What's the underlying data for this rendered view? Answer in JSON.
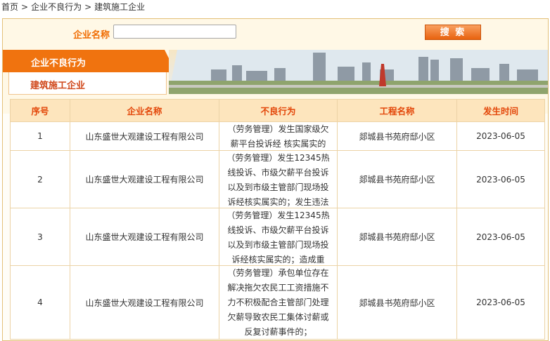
{
  "breadcrumb": [
    "首页",
    "企业不良行为",
    "建筑施工企业"
  ],
  "breadcrumb_sep": ">",
  "search": {
    "label": "企业名称",
    "value": "",
    "button": "搜  索"
  },
  "tabs": {
    "main": "企业不良行为",
    "sub": "建筑施工企业"
  },
  "table": {
    "headers": [
      "序号",
      "企业名称",
      "不良行为",
      "工程名称",
      "发生时间"
    ],
    "rows": [
      {
        "no": "1",
        "company": "山东盛世大观建设工程有限公司",
        "behavior": "（劳务管理）发生国家级欠薪平台投诉经 核实属实的",
        "project": "郯城县书苑府邸小区",
        "date": "2023-06-05"
      },
      {
        "no": "2",
        "company": "山东盛世大观建设工程有限公司",
        "behavior": "（劳务管理）发生12345热线投诉、市级欠薪平台投诉以及到市级主管部门现场投诉经核实属实的；发生违法违规行为的",
        "project": "郯城县书苑府邸小区",
        "date": "2023-06-05"
      },
      {
        "no": "3",
        "company": "山东盛世大观建设工程有限公司",
        "behavior": "（劳务管理）发生12345热线投诉、市级欠薪平台投诉以及到市级主管部门现场投诉经核实属实的；造成重办、督办的",
        "project": "郯城县书苑府邸小区",
        "date": "2023-06-05"
      },
      {
        "no": "4",
        "company": "山东盛世大观建设工程有限公司",
        "behavior": "（劳务管理）承包单位存在解决拖欠农民工工资措施不力不积极配合主管部门处理欠薪导致农民工集体讨薪或反复讨薪事件的；",
        "project": "郯城县书苑府邸小区",
        "date": "2023-06-05"
      }
    ]
  },
  "colors": {
    "accent": "#f0730f",
    "header_text": "#e3470a",
    "header_bg": "#fde5bd",
    "border": "#ecd3a6"
  }
}
